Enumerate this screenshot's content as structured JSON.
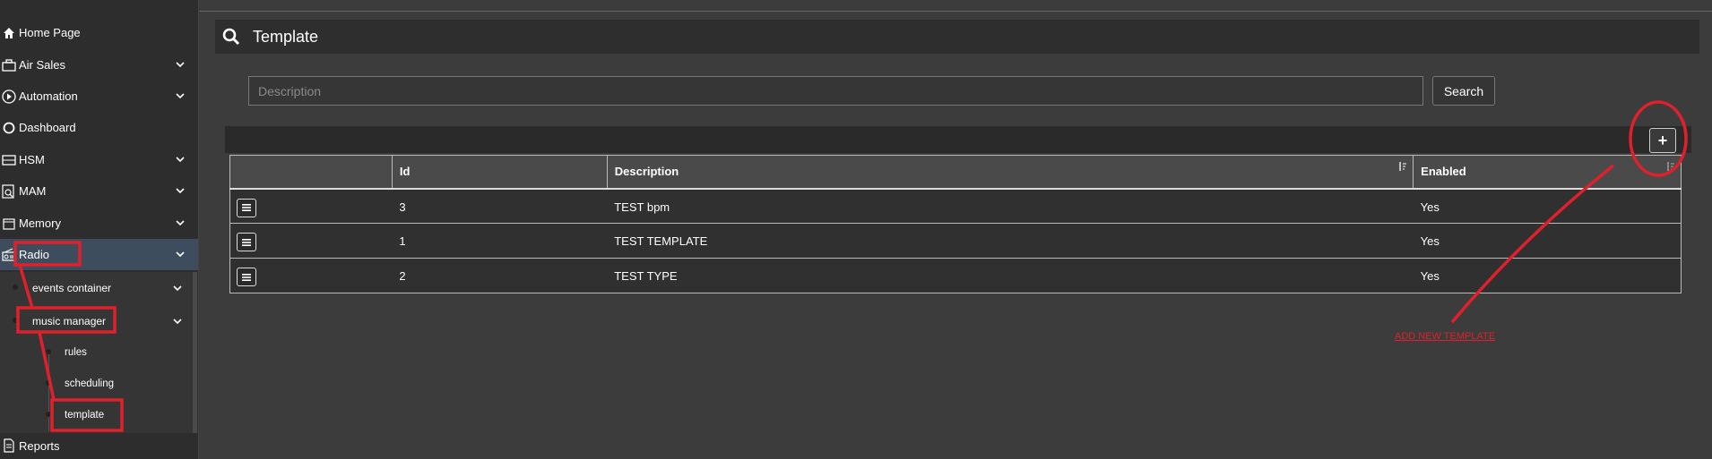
{
  "sidebar": {
    "items": [
      {
        "label": "Home Page",
        "icon": "home-icon"
      },
      {
        "label": "Air Sales",
        "icon": "briefcase-icon"
      },
      {
        "label": "Automation",
        "icon": "play-circle-icon"
      },
      {
        "label": "Dashboard",
        "icon": "circle-icon"
      },
      {
        "label": "HSM",
        "icon": "server-icon"
      },
      {
        "label": "MAM",
        "icon": "media-search-icon"
      },
      {
        "label": "Memory",
        "icon": "memory-icon"
      },
      {
        "label": "Radio",
        "icon": "radio-icon"
      },
      {
        "label": "Reports",
        "icon": "document-icon"
      }
    ],
    "sub_items": [
      {
        "label": "events container"
      },
      {
        "label": "music manager"
      }
    ],
    "subsub_items": [
      {
        "label": "rules"
      },
      {
        "label": "scheduling"
      },
      {
        "label": "template"
      }
    ]
  },
  "header": {
    "title": "Template"
  },
  "search": {
    "placeholder": "Description",
    "value": "",
    "button_label": "Search"
  },
  "table": {
    "add_label": "+",
    "columns": [
      "",
      "Id",
      "Description",
      "Enabled"
    ],
    "rows": [
      {
        "id": "3",
        "description": "TEST bpm",
        "enabled": "Yes"
      },
      {
        "id": "1",
        "description": "TEST TEMPLATE",
        "enabled": "Yes"
      },
      {
        "id": "2",
        "description": "TEST TYPE",
        "enabled": "Yes"
      }
    ]
  },
  "annotation": {
    "text": "ADD NEW TEMPLATE",
    "color": "#e0202a"
  },
  "colors": {
    "background": "#3c3c3c",
    "sidebar": "#2d2d2d",
    "active": "#3e4d5e",
    "highlight_red": "#e0202a"
  }
}
